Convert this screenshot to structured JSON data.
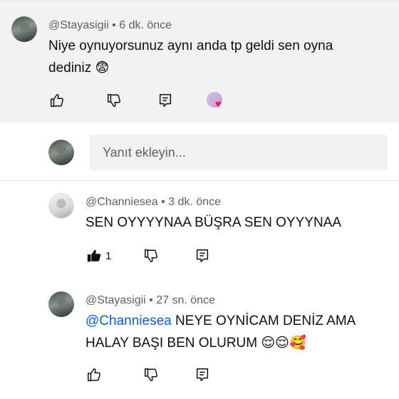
{
  "comments": [
    {
      "author": "@Stayasigii",
      "time": "6 dk. önce",
      "text_line1": "Niye oynuyorsunuz aynı anda tp geldi sen oyna",
      "text_line2": "dediniz",
      "emoji": "😨"
    },
    {
      "author": "@Channiesea",
      "time": "3 dk. önce",
      "text": "SEN OYYYYNAA BÜŞRA SEN OYYYNAA",
      "like_count": "1"
    },
    {
      "author": "@Stayasigii",
      "time": "27 sn. önce",
      "mention": "@Channiesea",
      "text_line1": " NEYE OYNİCAM DENİZ AMA",
      "text_line2": "HALAY BAŞI BEN OLURUM ",
      "emojis": "😌😌🥰"
    }
  ],
  "reply": {
    "placeholder": "Yanıt ekleyin..."
  },
  "separator": " • ",
  "icons": [
    "thumbs-up-icon",
    "thumbs-down-icon",
    "reply-icon",
    "creator-heart-icon"
  ],
  "colors": {
    "top_bg": "#f2f2f2",
    "meta": "#606060",
    "mention": "#065fd4",
    "heart": "#e0245e"
  }
}
